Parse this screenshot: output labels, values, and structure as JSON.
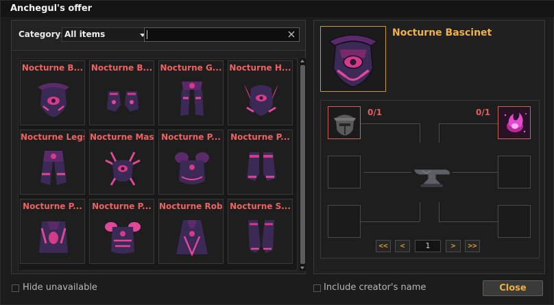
{
  "window": {
    "title": "Anchegul's offer"
  },
  "filter": {
    "category_label": "Category:",
    "category_value": "All items",
    "search_value": ""
  },
  "items": [
    {
      "name": "Nocturne B...",
      "icon": "bascinet-icon"
    },
    {
      "name": "Nocturne B...",
      "icon": "boots-icon"
    },
    {
      "name": "Nocturne G...",
      "icon": "greaves-icon"
    },
    {
      "name": "Nocturne H...",
      "icon": "helm-icon"
    },
    {
      "name": "Nocturne Legs",
      "icon": "legs-icon"
    },
    {
      "name": "Nocturne Mask",
      "icon": "mask-icon"
    },
    {
      "name": "Nocturne P...",
      "icon": "pauldrons-icon"
    },
    {
      "name": "Nocturne P...",
      "icon": "shoes-icon"
    },
    {
      "name": "Nocturne P...",
      "icon": "jerkin-icon"
    },
    {
      "name": "Nocturne P...",
      "icon": "chestplate-icon"
    },
    {
      "name": "Nocturne Robe",
      "icon": "robe-icon"
    },
    {
      "name": "Nocturne S...",
      "icon": "sabatons-icon"
    }
  ],
  "detail": {
    "name": "Nocturne Bascinet",
    "icon": "bascinet-icon",
    "ingredients": [
      {
        "count": "0/1",
        "icon": "stone-helm-icon"
      },
      {
        "count": "0/1",
        "icon": "magic-flame-icon"
      }
    ],
    "station_icon": "anvil-icon",
    "pager": {
      "first": "<<",
      "prev": "<",
      "page": "1",
      "next": ">",
      "last": ">>"
    }
  },
  "footer": {
    "hide_unavailable": "Hide unavailable",
    "include_creator": "Include creator's name",
    "close": "Close"
  },
  "colors": {
    "item_name": "#ee6262",
    "detail_name": "#f0b24a",
    "accent_border": "#c89a3a",
    "armor_primary": "#d63a8a",
    "armor_dark": "#2a2440"
  }
}
